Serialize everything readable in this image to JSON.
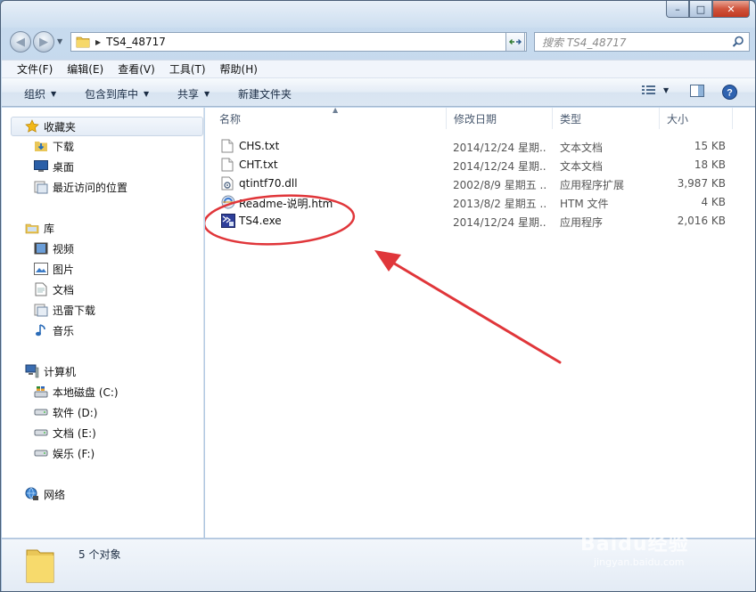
{
  "window": {
    "caption_min": "–",
    "caption_max": "□",
    "caption_close": "✕"
  },
  "address": {
    "path": "TS4_48717",
    "search_placeholder": "搜索 TS4_48717"
  },
  "menu": [
    "文件(F)",
    "编辑(E)",
    "查看(V)",
    "工具(T)",
    "帮助(H)"
  ],
  "toolbar": {
    "organize": "组织",
    "include_in_library": "包含到库中",
    "share": "共享",
    "new_folder": "新建文件夹"
  },
  "navpane": {
    "favorites": "收藏夹",
    "fav_items": [
      "下载",
      "桌面",
      "最近访问的位置"
    ],
    "libraries": "库",
    "lib_items": [
      "视频",
      "图片",
      "文档",
      "迅雷下载",
      "音乐"
    ],
    "computer": "计算机",
    "drives": [
      "本地磁盘 (C:)",
      "软件 (D:)",
      "文档 (E:)",
      "娱乐 (F:)"
    ],
    "network": "网络"
  },
  "columns": {
    "name": "名称",
    "date": "修改日期",
    "type": "类型",
    "size": "大小"
  },
  "files": [
    {
      "name": "CHS.txt",
      "date": "2014/12/24 星期...",
      "type": "文本文档",
      "size": "15 KB",
      "icon": "text-file-icon"
    },
    {
      "name": "CHT.txt",
      "date": "2014/12/24 星期...",
      "type": "文本文档",
      "size": "18 KB",
      "icon": "text-file-icon"
    },
    {
      "name": "qtintf70.dll",
      "date": "2002/8/9 星期五 ...",
      "type": "应用程序扩展",
      "size": "3,987 KB",
      "icon": "dll-file-icon"
    },
    {
      "name": "Readme-说明.htm",
      "date": "2013/8/2 星期五 ...",
      "type": "HTM 文件",
      "size": "4 KB",
      "icon": "htm-file-icon"
    },
    {
      "name": "TS4.exe",
      "date": "2014/12/24 星期...",
      "type": "应用程序",
      "size": "2,016 KB",
      "icon": "exe-file-icon"
    }
  ],
  "status": {
    "count": "5 个对象"
  },
  "watermark": {
    "brand": "Baidu经验",
    "url": "jingyan.baidu.com"
  },
  "colors": {
    "annotation_red": "#e0363a",
    "accent_blue": "#2c5a8e"
  }
}
